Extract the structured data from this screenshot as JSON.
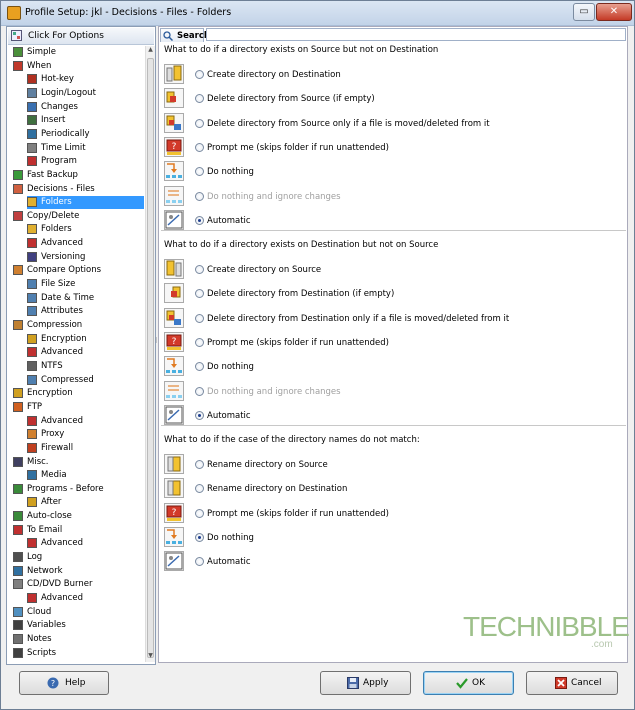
{
  "window": {
    "title": "Profile Setup: jkl - Decisions - Files - Folders"
  },
  "left_panel": {
    "header": "Click For Options",
    "tree": [
      {
        "label": "Simple",
        "level": 0,
        "icon": "simple-icon",
        "color": "#4a8f3a"
      },
      {
        "label": "When",
        "level": 0,
        "icon": "calendar-icon",
        "color": "#c0392b"
      },
      {
        "label": "Hot-key",
        "level": 1,
        "icon": "hotkey-icon",
        "color": "#b03020"
      },
      {
        "label": "Login/Logout",
        "level": 1,
        "icon": "login-icon",
        "color": "#6080a0"
      },
      {
        "label": "Changes",
        "level": 1,
        "icon": "changes-icon",
        "color": "#3a70b0"
      },
      {
        "label": "Insert",
        "level": 1,
        "icon": "insert-icon",
        "color": "#407040"
      },
      {
        "label": "Periodically",
        "level": 1,
        "icon": "periodic-icon",
        "color": "#3070a0"
      },
      {
        "label": "Time Limit",
        "level": 1,
        "icon": "timer-icon",
        "color": "#808080"
      },
      {
        "label": "Program",
        "level": 1,
        "icon": "program-icon",
        "color": "#c03030"
      },
      {
        "label": "Fast Backup",
        "level": 0,
        "icon": "fast-backup-icon",
        "color": "#3a9a3a"
      },
      {
        "label": "Decisions - Files",
        "level": 0,
        "icon": "decisions-icon",
        "color": "#d06040"
      },
      {
        "label": "Folders",
        "level": 1,
        "icon": "folder-icon",
        "color": "#e0b030",
        "selected": true
      },
      {
        "label": "Copy/Delete",
        "level": 0,
        "icon": "copy-delete-icon",
        "color": "#c04040"
      },
      {
        "label": "Folders",
        "level": 1,
        "icon": "folder-icon",
        "color": "#e0b030"
      },
      {
        "label": "Advanced",
        "level": 1,
        "icon": "advanced-icon",
        "color": "#c03030"
      },
      {
        "label": "Versioning",
        "level": 1,
        "icon": "versioning-icon",
        "color": "#404080"
      },
      {
        "label": "Compare Options",
        "level": 0,
        "icon": "compare-icon",
        "color": "#d08030"
      },
      {
        "label": "File Size",
        "level": 1,
        "icon": "file-size-icon",
        "color": "#5080b0"
      },
      {
        "label": "Date & Time",
        "level": 1,
        "icon": "date-time-icon",
        "color": "#5080b0"
      },
      {
        "label": "Attributes",
        "level": 1,
        "icon": "attributes-icon",
        "color": "#5080b0"
      },
      {
        "label": "Compression",
        "level": 0,
        "icon": "compression-icon",
        "color": "#c08030"
      },
      {
        "label": "Encryption",
        "level": 1,
        "icon": "lock-icon",
        "color": "#d0a020"
      },
      {
        "label": "Advanced",
        "level": 1,
        "icon": "advanced-icon",
        "color": "#c03030"
      },
      {
        "label": "NTFS",
        "level": 1,
        "icon": "ntfs-icon",
        "color": "#606060"
      },
      {
        "label": "Compressed",
        "level": 1,
        "icon": "compressed-icon",
        "color": "#5080b0"
      },
      {
        "label": "Encryption",
        "level": 0,
        "icon": "lock-icon",
        "color": "#d0a020"
      },
      {
        "label": "FTP",
        "level": 0,
        "icon": "ftp-icon",
        "color": "#d06020"
      },
      {
        "label": "Advanced",
        "level": 1,
        "icon": "advanced-icon",
        "color": "#c03030"
      },
      {
        "label": "Proxy",
        "level": 1,
        "icon": "proxy-icon",
        "color": "#d08030"
      },
      {
        "label": "Firewall",
        "level": 1,
        "icon": "firewall-icon",
        "color": "#c04020"
      },
      {
        "label": "Misc.",
        "level": 0,
        "icon": "misc-icon",
        "color": "#404060"
      },
      {
        "label": "Media",
        "level": 1,
        "icon": "media-icon",
        "color": "#3070a0"
      },
      {
        "label": "Programs - Before",
        "level": 0,
        "icon": "programs-before-icon",
        "color": "#3a8a3a"
      },
      {
        "label": "After",
        "level": 1,
        "icon": "after-icon",
        "color": "#d0a020"
      },
      {
        "label": "Auto-close",
        "level": 0,
        "icon": "auto-close-icon",
        "color": "#3a8a3a"
      },
      {
        "label": "To Email",
        "level": 0,
        "icon": "email-icon",
        "color": "#c03030"
      },
      {
        "label": "Advanced",
        "level": 1,
        "icon": "advanced-icon",
        "color": "#c03030"
      },
      {
        "label": "Log",
        "level": 0,
        "icon": "log-icon",
        "color": "#505050"
      },
      {
        "label": "Network",
        "level": 0,
        "icon": "network-icon",
        "color": "#3070a0"
      },
      {
        "label": "CD/DVD Burner",
        "level": 0,
        "icon": "cd-icon",
        "color": "#808080"
      },
      {
        "label": "Advanced",
        "level": 1,
        "icon": "advanced-icon",
        "color": "#c03030"
      },
      {
        "label": "Cloud",
        "level": 0,
        "icon": "cloud-icon",
        "color": "#5090c0"
      },
      {
        "label": "Variables",
        "level": 0,
        "icon": "variables-icon",
        "color": "#404040"
      },
      {
        "label": "Notes",
        "level": 0,
        "icon": "notes-icon",
        "color": "#707070"
      },
      {
        "label": "Scripts",
        "level": 0,
        "icon": "scripts-icon",
        "color": "#404040"
      }
    ]
  },
  "search": {
    "label": "Search",
    "value": ""
  },
  "sections": [
    {
      "heading": "What to do if a directory exists on Source but not on Destination",
      "options": [
        {
          "label": "Create directory on Destination",
          "selected": false,
          "disabled": false,
          "icon": "create-dir-dest-icon"
        },
        {
          "label": "Delete directory from Source (if empty)",
          "selected": false,
          "disabled": false,
          "icon": "delete-dir-source-icon"
        },
        {
          "label": "Delete directory from Source only if a file is moved/deleted from it",
          "selected": false,
          "disabled": false,
          "icon": "delete-dir-source-moved-icon"
        },
        {
          "label": "Prompt me (skips folder if run unattended)",
          "selected": false,
          "disabled": false,
          "icon": "prompt-icon"
        },
        {
          "label": "Do nothing",
          "selected": false,
          "disabled": false,
          "icon": "do-nothing-icon"
        },
        {
          "label": "Do nothing and ignore changes",
          "selected": false,
          "disabled": true,
          "icon": "ignore-changes-icon"
        },
        {
          "label": "Automatic",
          "selected": true,
          "disabled": false,
          "icon": "automatic-icon"
        }
      ]
    },
    {
      "heading": "What to do if a directory exists on Destination but not on Source",
      "options": [
        {
          "label": "Create directory on Source",
          "selected": false,
          "disabled": false,
          "icon": "create-dir-source-icon"
        },
        {
          "label": "Delete directory from Destination (if empty)",
          "selected": false,
          "disabled": false,
          "icon": "delete-dir-dest-icon"
        },
        {
          "label": "Delete directory from Destination only if a file is moved/deleted from it",
          "selected": false,
          "disabled": false,
          "icon": "delete-dir-dest-moved-icon"
        },
        {
          "label": "Prompt me (skips folder if run unattended)",
          "selected": false,
          "disabled": false,
          "icon": "prompt-icon"
        },
        {
          "label": "Do nothing",
          "selected": false,
          "disabled": false,
          "icon": "do-nothing-icon"
        },
        {
          "label": "Do nothing and ignore changes",
          "selected": false,
          "disabled": true,
          "icon": "ignore-changes-icon"
        },
        {
          "label": "Automatic",
          "selected": true,
          "disabled": false,
          "icon": "automatic-icon"
        }
      ]
    },
    {
      "heading": "What to do if the case of the directory names do not match:",
      "options": [
        {
          "label": "Rename directory on Source",
          "selected": false,
          "disabled": false,
          "icon": "rename-source-icon"
        },
        {
          "label": "Rename directory on Destination",
          "selected": false,
          "disabled": false,
          "icon": "rename-dest-icon"
        },
        {
          "label": "Prompt me (skips folder if run unattended)",
          "selected": false,
          "disabled": false,
          "icon": "prompt-icon"
        },
        {
          "label": "Do nothing",
          "selected": true,
          "disabled": false,
          "icon": "do-nothing-icon"
        },
        {
          "label": "Automatic",
          "selected": false,
          "disabled": false,
          "icon": "automatic-icon"
        }
      ]
    }
  ],
  "watermark": {
    "brand": "TECHNIBBLE",
    "suffix": ".com"
  },
  "buttons": {
    "help": "Help",
    "apply": "Apply",
    "ok": "OK",
    "cancel": "Cancel"
  }
}
